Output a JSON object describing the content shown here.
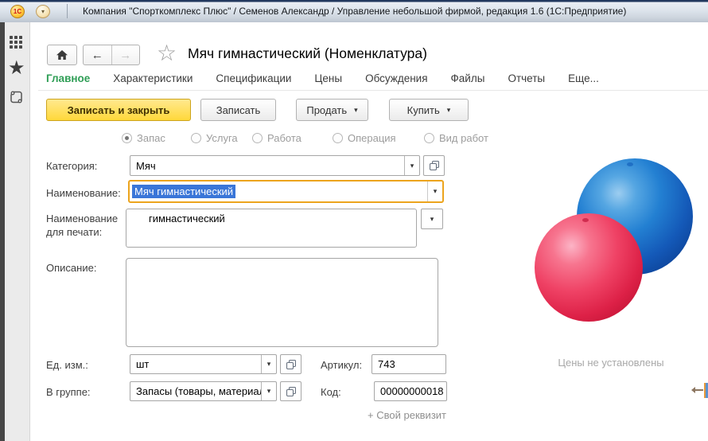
{
  "titlebar": {
    "logo_text": "1С",
    "title": "Компания \"Спорткомплекс Плюс\" / Семенов Александр / Управление небольшой фирмой, редакция 1.6 (1С:Предприятие)"
  },
  "icons": {
    "chevron_down": "▾",
    "back": "←",
    "forward": "→",
    "favorite_outline": "☆",
    "favorite_filled": "★",
    "home": "house-css-shape",
    "apps_grid": "grid-css-shape",
    "history_scroll": "scroll-css-shape",
    "open_value": "overlapping-squares-css-shape"
  },
  "header": {
    "title": "Мяч гимнастический (Номенклатура)"
  },
  "tabs": [
    {
      "label": "Главное",
      "active": true
    },
    {
      "label": "Характеристики",
      "active": false
    },
    {
      "label": "Спецификации",
      "active": false
    },
    {
      "label": "Цены",
      "active": false
    },
    {
      "label": "Обсуждения",
      "active": false
    },
    {
      "label": "Файлы",
      "active": false
    },
    {
      "label": "Отчеты",
      "active": false
    },
    {
      "label": "Еще...",
      "active": false
    }
  ],
  "toolbar": {
    "save_close_label": "Записать и закрыть",
    "save_label": "Записать",
    "sell_label": "Продать",
    "buy_label": "Купить"
  },
  "item_type": {
    "options": [
      {
        "label": "Запас",
        "selected": true
      },
      {
        "label": "Услуга",
        "selected": false
      },
      {
        "label": "Работа",
        "selected": false
      },
      {
        "label": "Операция",
        "selected": false
      },
      {
        "label": "Вид работ",
        "selected": false
      }
    ]
  },
  "form": {
    "category": {
      "label": "Категория:",
      "value": "Мяч"
    },
    "name": {
      "label": "Наименование:",
      "value": "Мяч гимнастический",
      "selected": true
    },
    "print_name": {
      "label": "Наименование для печати:",
      "value": "гимнастический"
    },
    "description": {
      "label": "Описание:",
      "value": ""
    },
    "unit": {
      "label": "Ед. изм.:",
      "value": "шт"
    },
    "group": {
      "label": "В группе:",
      "value": "Запасы (товары, материал"
    },
    "article": {
      "label": "Артикул:",
      "value": "743"
    },
    "code": {
      "label": "Код:",
      "value": "00000000018"
    },
    "custom_attribute_link": "+ Свой реквизит"
  },
  "right_panel": {
    "prices_status": "Цены не установлены"
  },
  "colors": {
    "accent_green": "#2f9e56",
    "focus_border": "#eca41d",
    "save_button_yellow": "#ffd83a",
    "selection_blue": "#3a76d8",
    "ball_blue": "#1a63c8",
    "ball_red": "#e62e52"
  }
}
